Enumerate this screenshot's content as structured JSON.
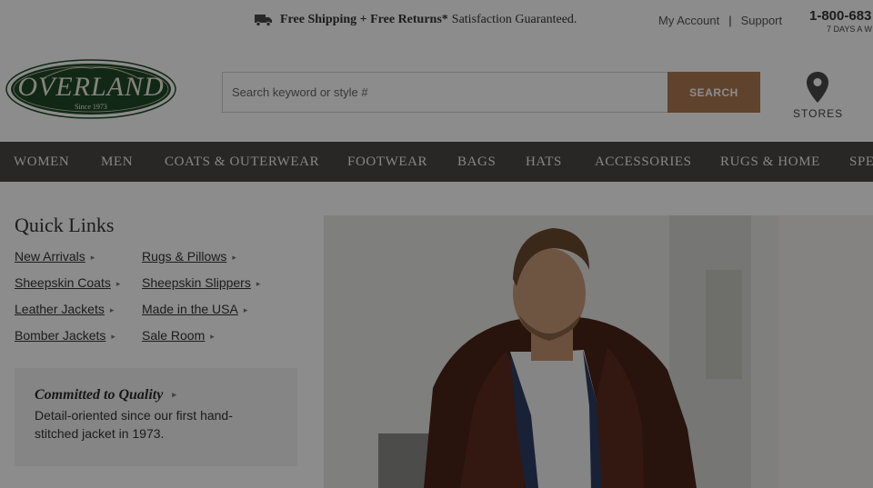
{
  "topbar": {
    "shipping_bold": "Free Shipping + Free Returns*",
    "shipping_text": "Satisfaction Guaranteed.",
    "my_account": "My Account",
    "separator": "|",
    "support": "Support",
    "phone": "1-800-683",
    "phone_hours": "7 DAYS A W"
  },
  "header": {
    "logo_name": "OVERLAND",
    "logo_since": "Since 1973",
    "search_placeholder": "Search keyword or style #",
    "search_button": "SEARCH",
    "stores_label": "STORES"
  },
  "nav": {
    "items": [
      "WOMEN",
      "MEN",
      "COATS & OUTERWEAR",
      "FOOTWEAR",
      "BAGS",
      "HATS",
      "ACCESSORIES",
      "RUGS & HOME",
      "SPE"
    ]
  },
  "quick_links": {
    "title": "Quick Links",
    "links": [
      "New Arrivals",
      "Sheepskin Coats",
      "Leather Jackets",
      "Bomber Jackets",
      "Rugs & Pillows",
      "Sheepskin Slippers",
      "Made in the USA",
      "Sale Room"
    ],
    "arrow": "▸"
  },
  "quality": {
    "title": "Committed to Quality",
    "description": "Detail-oriented since our first hand-stitched jacket in 1973."
  },
  "colors": {
    "nav_bg": "#4a4746",
    "search_button": "#b07a53",
    "logo_green": "#1f4a2a",
    "overlay": "rgba(0,0,0,0.45)"
  },
  "icons": {
    "shipping": "truck-icon",
    "stores": "map-pin-icon"
  }
}
